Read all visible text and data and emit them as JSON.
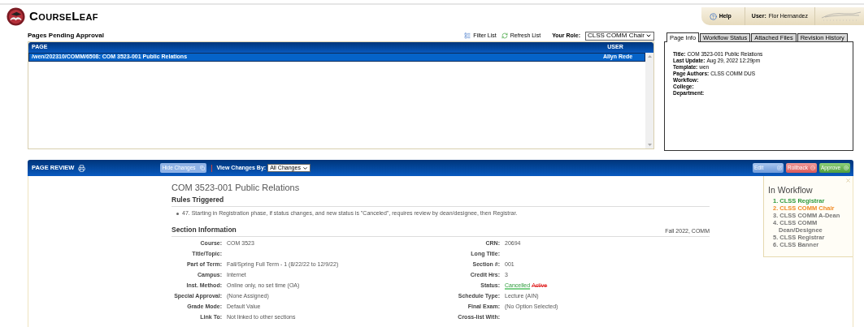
{
  "header": {
    "app_name": "CourseLeaf",
    "help": "Help",
    "user_label": "User:",
    "user_name": "Flor Hernandez"
  },
  "pending": {
    "title": "Pages Pending Approval",
    "filter": "Filter List",
    "refresh": "Refresh List",
    "role_label": "Your Role:",
    "role": "CLSS COMM Chair",
    "columns": [
      "PAGE",
      "USER"
    ],
    "rows": [
      {
        "page": "/wen/202310/COMM/6508: COM 3523-001 Public Relations",
        "user": "Allyn Rede",
        "selected": true
      }
    ]
  },
  "info_tabs": [
    {
      "label": "Page Info",
      "selected": true
    },
    {
      "label": "Workflow Status",
      "selected": false
    },
    {
      "label": "Attached Files",
      "selected": false
    },
    {
      "label": "Revision History",
      "selected": false
    }
  ],
  "page_info": [
    {
      "label": "Title:",
      "value": "COM 3523-001 Public Relations"
    },
    {
      "label": "Last Update:",
      "value": "Aug 29, 2022 12:29pm"
    },
    {
      "label": "Template:",
      "value": "wen"
    },
    {
      "label": "Page Authors:",
      "value": "CLSS COMM DUS"
    },
    {
      "label": "Workflow:"
    },
    {
      "label": "College:"
    },
    {
      "label": "Department:"
    }
  ],
  "review": {
    "title": "PAGE REVIEW",
    "hide_changes": "Hide Changes",
    "view_by_label": "View Changes By:",
    "view_by": "All Changes",
    "actions": [
      {
        "label": "Edit",
        "kind": "edit"
      },
      {
        "label": "Rollback",
        "kind": "rollback"
      },
      {
        "label": "Approve",
        "kind": "approve"
      }
    ],
    "course_title": "COM 3523-001 Public Relations",
    "rules_heading": "Rules Triggered",
    "rules": [
      "47. Starting in Registration phase, if status changes, and new status is \"Canceled\", requires review by dean/designee, then Registrar."
    ],
    "section_heading": "Section Information",
    "term": "Fall 2022, COMM",
    "fields_left": [
      {
        "label": "Course:",
        "value": "COM 3523"
      },
      {
        "label": "Title/Topic:"
      },
      {
        "label": "Part of Term:",
        "value": "Fall/Spring Full Term - 1 (8/22/22 to 12/9/22)"
      },
      {
        "label": "Campus:",
        "value": "Internet"
      },
      {
        "label": "Inst. Method:",
        "value": "Online only, no set time (OA)"
      },
      {
        "label": "Special Approval:",
        "value": "(None Assigned)"
      },
      {
        "label": "Grade Mode:",
        "value": "Default Value"
      },
      {
        "label": "Link To:",
        "value": "Not linked to other sections"
      }
    ],
    "fields_right": [
      {
        "label": "CRN:",
        "value": "20694"
      },
      {
        "label": "Long Title:"
      },
      {
        "label": "Section #:",
        "value": "001"
      },
      {
        "label": "Credit Hrs:",
        "value": "3"
      },
      {
        "label": "Status:",
        "changes": [
          {
            "text": "Cancelled",
            "kind": "added"
          },
          {
            "text": "Active",
            "kind": "removed"
          }
        ]
      },
      {
        "label": "Schedule Type:",
        "value": "Lecture (AIN)"
      },
      {
        "label": "Final Exam:",
        "value": "(No Option Selected)"
      },
      {
        "label": "Cross-list With:"
      }
    ]
  },
  "workflow": {
    "title": "In Workflow",
    "steps": [
      {
        "label": "1. CLSS Registrar",
        "color": "#2e9a3c"
      },
      {
        "label": "2. CLSS COMM Chair",
        "color": "#f08a24"
      },
      {
        "label": "3. CLSS COMM A-Dean",
        "color": "#777777"
      },
      {
        "label": "4. CLSS COMM Dean/Designee",
        "color": "#777777"
      },
      {
        "label": "5. CLSS Registrar",
        "color": "#777777"
      },
      {
        "label": "6. CLSS Banner",
        "color": "#777777"
      }
    ]
  }
}
